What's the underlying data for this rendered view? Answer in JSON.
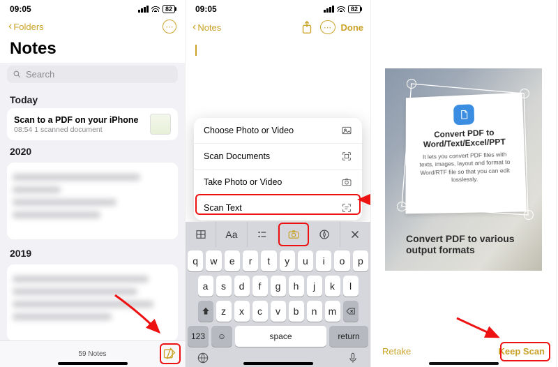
{
  "status": {
    "time": "09:05",
    "battery": "82"
  },
  "phone1": {
    "nav": {
      "back": "Folders"
    },
    "title": "Notes",
    "search_placeholder": "Search",
    "sections": {
      "today": "Today",
      "y2020": "2020",
      "y2019": "2019"
    },
    "today_note": {
      "title": "Scan to a PDF on your iPhone",
      "subtitle": "08:54  1 scanned document"
    },
    "footer_count": "59 Notes"
  },
  "phone2": {
    "nav": {
      "back": "Notes",
      "done": "Done"
    },
    "menu": {
      "choose": "Choose Photo or Video",
      "scan_docs": "Scan Documents",
      "take": "Take Photo or Video",
      "scan_text": "Scan Text"
    },
    "toolbar": {
      "aa": "Aa"
    },
    "keyboard": {
      "r1": [
        "q",
        "w",
        "e",
        "r",
        "t",
        "y",
        "u",
        "i",
        "o",
        "p"
      ],
      "r2": [
        "a",
        "s",
        "d",
        "f",
        "g",
        "h",
        "j",
        "k",
        "l"
      ],
      "r3": [
        "z",
        "x",
        "c",
        "v",
        "b",
        "n",
        "m"
      ],
      "num": "123",
      "space": "space",
      "return": "return"
    }
  },
  "phone3": {
    "doc": {
      "heading": "Convert PDF to Word/Text/Excel/PPT",
      "body": "It lets you convert PDF files with texts, images, layout and format to Word/RTF file so that you can edit losslessly."
    },
    "below": "Convert PDF to various output formats",
    "retake": "Retake",
    "keep": "Keep Scan"
  }
}
